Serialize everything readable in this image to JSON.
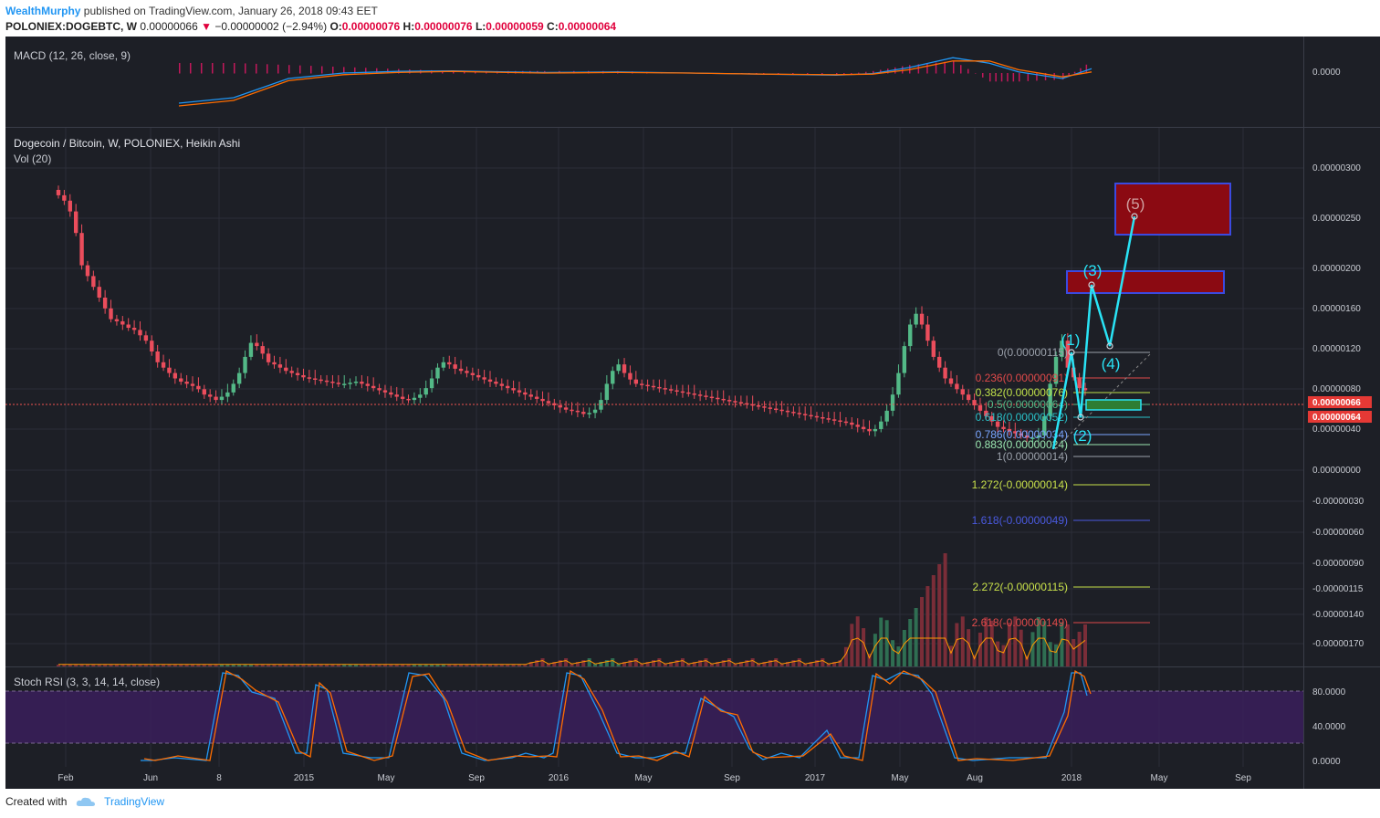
{
  "header": {
    "author": "WealthMurphy",
    "published": "published on TradingView.com, January 26, 2018 09:43 EET",
    "symbol": "POLONIEX:DOGEBTC, W",
    "last": "0.00000066",
    "change": "−0.00000002 (−2.94%)",
    "o_label": "O:",
    "o": "0.00000076",
    "h_label": "H:",
    "h": "0.00000076",
    "l_label": "L:",
    "l": "0.00000059",
    "c_label": "C:",
    "c": "0.00000064"
  },
  "footer": {
    "created_with": "Created with",
    "brand": "TradingView"
  },
  "colors": {
    "background": "#1d1f26",
    "grid": "#2b2e38",
    "up": "#53b987",
    "down": "#eb4d5c",
    "macd": "#2196f3",
    "signal": "#ff6d00",
    "wave": "#29e3f5",
    "target_box": "#8b0a12",
    "target_border": "#3b4ae0",
    "stoch_band": "#3a1f5c"
  },
  "chart_data": [
    {
      "type": "line",
      "panel": "macd",
      "title": "MACD (12, 26, close, 9)",
      "y_tick_labels": [
        "0.0000"
      ],
      "series": [
        {
          "name": "MACD",
          "color": "#2196f3",
          "x": [
            0,
            15,
            30,
            45,
            60,
            75,
            90,
            100,
            120,
            140,
            150,
            160,
            180,
            190,
            200,
            212,
            222,
            230,
            242,
            250
          ],
          "y": [
            -55,
            -45,
            -10,
            0,
            3,
            4,
            2,
            1,
            2,
            0,
            -1,
            -2,
            -4,
            -1,
            10,
            28,
            18,
            2,
            -10,
            8
          ]
        },
        {
          "name": "Signal",
          "color": "#ff6d00",
          "x": [
            0,
            15,
            30,
            45,
            60,
            75,
            90,
            100,
            120,
            140,
            150,
            160,
            180,
            190,
            200,
            212,
            222,
            230,
            242,
            250
          ],
          "y": [
            -60,
            -50,
            -14,
            -3,
            1,
            3,
            1,
            0,
            1,
            0,
            -1,
            -2,
            -3,
            -2,
            6,
            22,
            22,
            6,
            -7,
            2
          ]
        }
      ]
    },
    {
      "type": "candlestick",
      "panel": "price",
      "title": "Dogecoin / Bitcoin, W, POLONIEX, Heikin Ashi",
      "volume_label": "Vol (20)",
      "x_tick_labels": [
        "Feb",
        "Jun",
        "8",
        "2015",
        "May",
        "Sep",
        "2016",
        "May",
        "Sep",
        "2017",
        "May",
        "Aug",
        "2018",
        "May",
        "Sep"
      ],
      "y_tick_labels": [
        "0.00000300",
        "0.00000250",
        "0.00000200",
        "0.00000160",
        "0.00000120",
        "0.00000080",
        "0.00000040",
        "0.00000000",
        "-0.00000030",
        "-0.00000060",
        "-0.00000090",
        "-0.00000115",
        "-0.00000140",
        "-0.00000170"
      ],
      "close": [
        245,
        240,
        230,
        210,
        180,
        170,
        160,
        150,
        140,
        130,
        128,
        125,
        122,
        120,
        115,
        110,
        100,
        90,
        85,
        80,
        75,
        72,
        70,
        68,
        65,
        60,
        58,
        55,
        58,
        62,
        70,
        80,
        95,
        108,
        105,
        98,
        90,
        88,
        85,
        82,
        80,
        78,
        76,
        75,
        74,
        73,
        72,
        71,
        70,
        70,
        71,
        72,
        70,
        68,
        66,
        64,
        62,
        60,
        58,
        56,
        55,
        57,
        60,
        66,
        75,
        85,
        90,
        88,
        84,
        82,
        80,
        78,
        76,
        74,
        72,
        70,
        68,
        66,
        64,
        62,
        60,
        58,
        56,
        54,
        52,
        50,
        48,
        46,
        45,
        44,
        42,
        43,
        46,
        55,
        70,
        82,
        88,
        80,
        74,
        70,
        69,
        68,
        67,
        66,
        65,
        64,
        63,
        62,
        61,
        60,
        59,
        58,
        57,
        56,
        55,
        54,
        53,
        52,
        51,
        50,
        49,
        48,
        47,
        46,
        45,
        44,
        43,
        42,
        41,
        40,
        39,
        38,
        37,
        36,
        35,
        34,
        32,
        30,
        28,
        26,
        28,
        35,
        45,
        60,
        80,
        105,
        125,
        135,
        125,
        110,
        95,
        85,
        75,
        70,
        65,
        60,
        55,
        50,
        45,
        40,
        35,
        30,
        28,
        26,
        24,
        22,
        20,
        20,
        22,
        40,
        70,
        95,
        110,
        85,
        76,
        66,
        64
      ]
    },
    {
      "type": "line",
      "panel": "stoch_rsi",
      "title": "Stoch RSI (3, 3, 14, 14, close)",
      "y_tick_labels": [
        "80.0000",
        "40.0000",
        "0.0000"
      ],
      "ylim": [
        0,
        100
      ]
    }
  ],
  "fibs": [
    {
      "label": "0(0.00000115)",
      "color": "#9aa0aa"
    },
    {
      "label": "0.236(0.00000091)",
      "color": "#e04a4a"
    },
    {
      "label": "0.382(0.00000076)",
      "color": "#bfe04a"
    },
    {
      "label": "0.5(0.00000064)",
      "color": "#53b987"
    },
    {
      "label": "0.618(0.00000052)",
      "color": "#29c0c8"
    },
    {
      "label": "0.786(0.00000034)",
      "color": "#7aa6ff"
    },
    {
      "label": "0.883(0.00000024)",
      "color": "#9ae6b0"
    },
    {
      "label": "1(0.00000014)",
      "color": "#9aa0aa"
    },
    {
      "label": "1.272(-0.00000014)",
      "color": "#c8e04a"
    },
    {
      "label": "1.618(-0.00000049)",
      "color": "#4a5ae0"
    },
    {
      "label": "2.272(-0.00000115)",
      "color": "#c8e04a"
    },
    {
      "label": "2.618(-0.00000149)",
      "color": "#e04a4a"
    }
  ],
  "waves": [
    "(1)",
    "(2)",
    "(3)",
    "(4)",
    "(5)"
  ],
  "price_tags": [
    "0.00000066",
    "0.00000064"
  ]
}
